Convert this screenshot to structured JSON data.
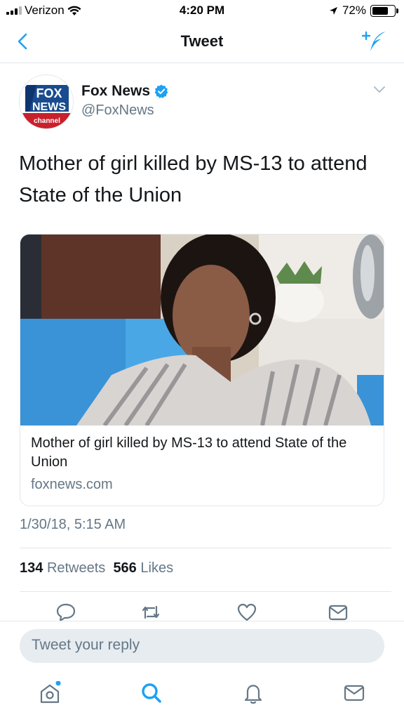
{
  "status_bar": {
    "carrier": "Verizon",
    "time": "4:20 PM",
    "battery": "72%",
    "battery_level": 0.72
  },
  "nav": {
    "title": "Tweet",
    "back_icon": "chevron-left-icon",
    "compose_icon": "compose-tweet-icon"
  },
  "tweet": {
    "author_name": "Fox News",
    "author_handle": "@FoxNews",
    "avatar_lines": [
      "FOX",
      "NEWS",
      "channel"
    ],
    "verified": true,
    "text": "Mother of girl killed by MS-13 to attend State of the Union",
    "card": {
      "title": "Mother of girl killed by MS-13 to attend State of the Union",
      "domain": "foxnews.com"
    },
    "timestamp": "1/30/18, 5:15 AM",
    "retweets_count": "134",
    "retweets_label": "Retweets",
    "likes_count": "566",
    "likes_label": "Likes"
  },
  "reply": {
    "placeholder": "Tweet your reply"
  },
  "colors": {
    "accent": "#1da1f2",
    "muted": "#657786",
    "text": "#14171a"
  }
}
